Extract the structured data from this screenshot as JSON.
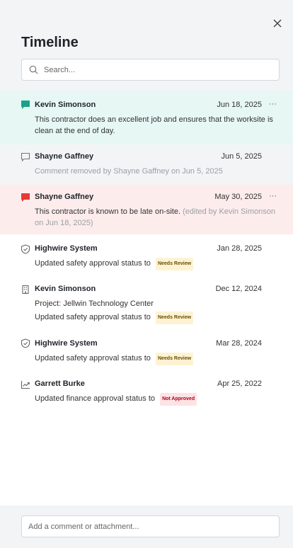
{
  "header": {
    "title": "Timeline",
    "close_icon": "close-icon"
  },
  "search": {
    "placeholder": "Search..."
  },
  "entries": [
    {
      "icon": "comment-filled-teal-icon",
      "name": "Kevin Simonson",
      "date": "Jun 18, 2025",
      "more": "···",
      "lines": [
        "This contractor does an excellent job and ensures that the worksite is",
        "clean at the end of day."
      ]
    },
    {
      "icon": "comment-outline-icon",
      "name": "Shayne Gaffney",
      "date": "Jun 5, 2025",
      "lines": [
        "Comment removed by Shayne Gaffney on Jun 5, 2025"
      ]
    },
    {
      "icon": "comment-filled-red-icon",
      "name": "Shayne Gaffney",
      "date": "May 30, 2025",
      "more": "···",
      "text": "This contractor is known to be late on-site.",
      "edited_1": "(edited by Kevin Simonson",
      "edited_2": "on Jun 18, 2025)"
    },
    {
      "icon": "shield-check-icon",
      "name": "Highwire System",
      "date": "Jan 28, 2025",
      "text": "Updated safety approval status to",
      "badge": "Needs Review"
    },
    {
      "icon": "building-icon",
      "name": "Kevin Simonson",
      "date": "Dec 12, 2024",
      "project": "Project: Jellwin Technology Center",
      "text": "Updated safety approval status to",
      "badge": "Needs Review"
    },
    {
      "icon": "shield-check-icon",
      "name": "Highwire System",
      "date": "Mar 28, 2024",
      "text": "Updated safety approval status to",
      "badge": "Needs Review"
    },
    {
      "icon": "trend-chart-icon",
      "name": "Garrett Burke",
      "date": "Apr 25, 2022",
      "text": "Updated finance approval status to",
      "badge": "Not Approved"
    }
  ],
  "footer": {
    "comment_placeholder": "Add a comment or attachment..."
  },
  "colors": {
    "header_bg": "#f3f4f6",
    "teal_highlight": "#e6f7f4",
    "gray_highlight": "#f3f4f6",
    "red_highlight": "#fdecec",
    "teal_icon": "#1aa38a",
    "red_icon": "#e53935",
    "needs_review_bg": "#fdf3d3",
    "not_approved_bg": "#fde3e3"
  }
}
